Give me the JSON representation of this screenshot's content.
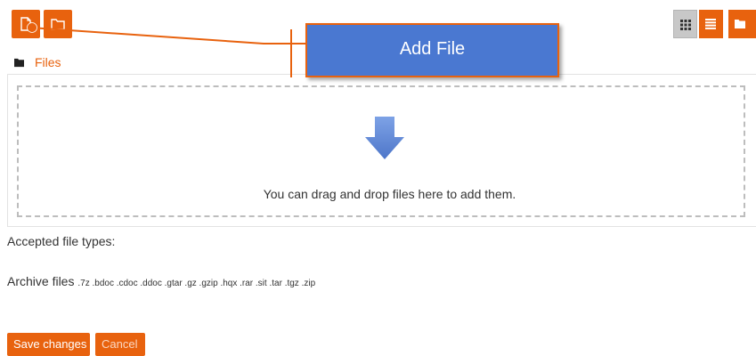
{
  "toolbar": {
    "add_file_icon": "file-icon",
    "create_folder_icon": "folder-icon"
  },
  "views": {
    "icons_icon": "grid-icon",
    "list_icon": "list-icon",
    "tree_icon": "folder-icon"
  },
  "path": {
    "label": "Files"
  },
  "dropzone": {
    "message": "You can drag and drop files here to add them."
  },
  "accepted": {
    "heading": "Accepted file types:",
    "archive_label": "Archive files",
    "archive_extensions": ".7z .bdoc .cdoc .ddoc .gtar .gz .gzip .hqx .rar .sit .tar .tgz .zip"
  },
  "actions": {
    "save": "Save changes",
    "cancel": "Cancel"
  },
  "callout": {
    "text": "Add File"
  },
  "colors": {
    "accent": "#e8620e",
    "callout_fill": "#4a78d1",
    "drop_arrow": "#5b85d6"
  }
}
